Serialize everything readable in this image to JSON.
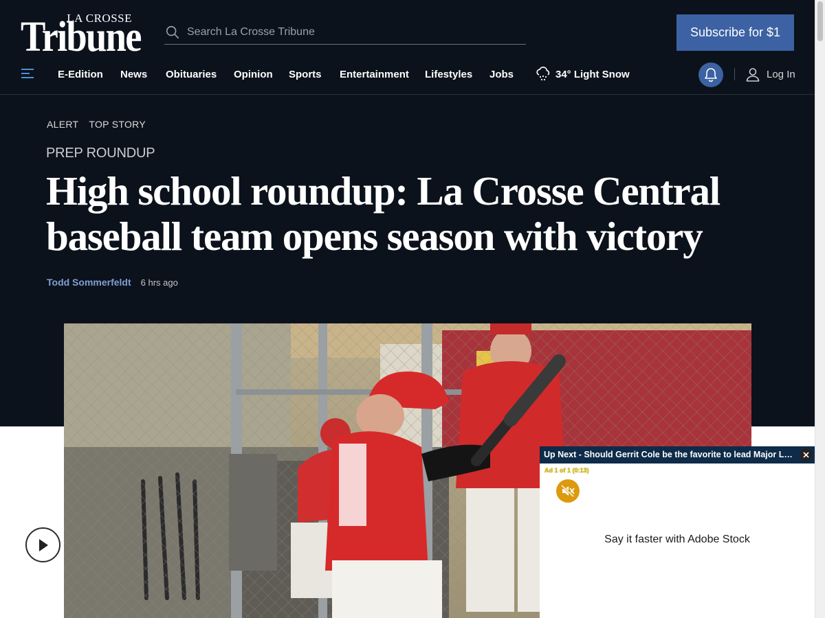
{
  "header": {
    "logo_small": "LA CROSSE",
    "logo_big": "Tribune",
    "search_placeholder": "Search La Crosse Tribune",
    "subscribe_label": "Subscribe for $1"
  },
  "nav": {
    "items": [
      {
        "label": "E-Edition"
      },
      {
        "label": "News"
      },
      {
        "label": "Obituaries"
      },
      {
        "label": "Opinion"
      },
      {
        "label": "Sports"
      },
      {
        "label": "Entertainment"
      },
      {
        "label": "Lifestyles"
      },
      {
        "label": "Jobs"
      }
    ],
    "weather": "34° Light Snow",
    "login_label": "Log In"
  },
  "article": {
    "tags": [
      "ALERT",
      "TOP STORY"
    ],
    "kicker": "PREP ROUNDUP",
    "headline": "High school roundup: La Crosse Central baseball team opens season with victory",
    "author": "Todd Sommerfeldt",
    "time": "6 hrs ago"
  },
  "video": {
    "up_next": "Up Next - Should Gerrit Cole be the favorite to lead Major League Baseball in strikeouts?",
    "ad_count": "Ad 1 of 1 (0:13)",
    "ad_text": "Say it faster with Adobe Stock"
  },
  "colors": {
    "header_bg": "#0c121b",
    "accent_blue": "#3c62a3",
    "author_link": "#7f9fd4",
    "video_bar": "#0e2b49",
    "mute_button": "#dc9a0c"
  }
}
